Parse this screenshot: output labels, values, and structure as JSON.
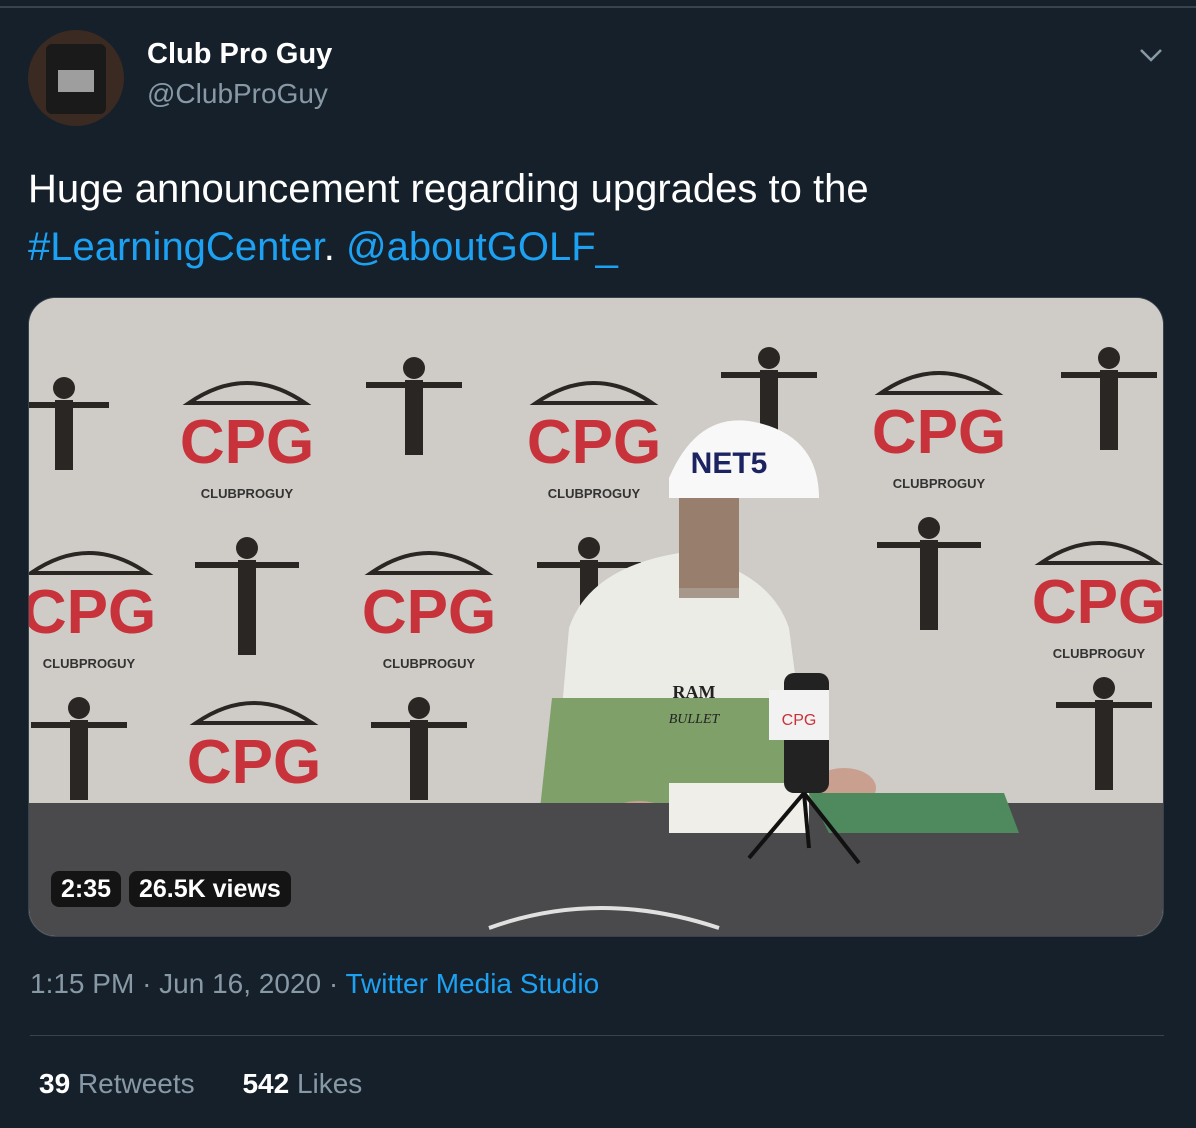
{
  "user": {
    "name": "Club Pro Guy",
    "handle": "@ClubProGuy"
  },
  "tweet": {
    "text_before": "Huge announcement regarding upgrades to the",
    "hashtag": "#LearningCenter",
    "separator": ".",
    "mention": "@aboutGOLF_"
  },
  "video": {
    "duration": "2:35",
    "views": "26.5K views",
    "backdrop_logo": "CPG",
    "backdrop_wordmark": "CLUBPROGUY",
    "hat_text": "NET5",
    "shirt_text_1": "RAM",
    "shirt_text_2": "BULLET",
    "mic_flag": "CPG"
  },
  "meta": {
    "time": "1:15 PM",
    "date": "Jun 16, 2020",
    "dot": "·",
    "source": "Twitter Media Studio"
  },
  "stats": {
    "retweets_count": "39",
    "retweets_label": "Retweets",
    "likes_count": "542",
    "likes_label": "Likes"
  },
  "colors": {
    "background": "#15202b",
    "link": "#1da1f2",
    "muted": "#8899a6",
    "border": "#38444d",
    "logo_red": "#c8323a"
  }
}
